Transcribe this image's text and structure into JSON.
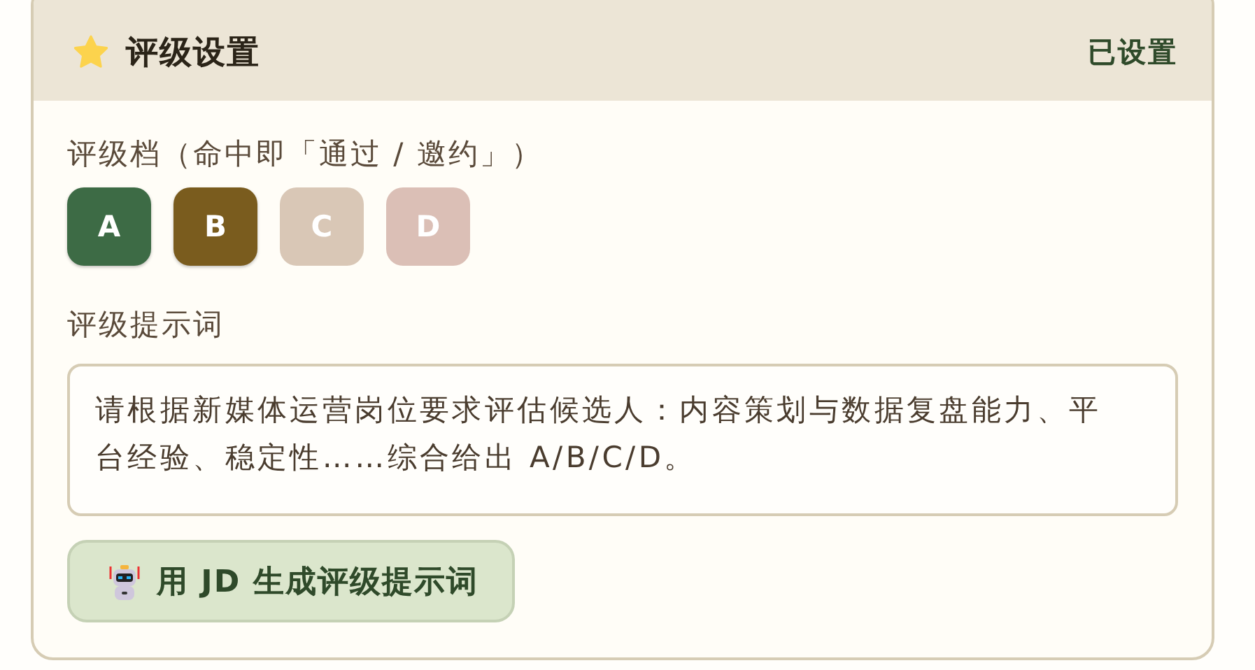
{
  "panel": {
    "title": "评级设置",
    "status": "已设置"
  },
  "grades": {
    "label": "评级档（命中即「通过 / 邀约」）",
    "items": [
      {
        "label": "A",
        "selected": true,
        "color": "#3d6b45"
      },
      {
        "label": "B",
        "selected": true,
        "color": "#7a5c1e"
      },
      {
        "label": "C",
        "selected": false,
        "color": "#d9c7b6"
      },
      {
        "label": "D",
        "selected": false,
        "color": "#dbbfb6"
      }
    ]
  },
  "prompt": {
    "label": "评级提示词",
    "value": "请根据新媒体运营岗位要求评估候选人：内容策划与数据复盘能力、平台经验、稳定性……综合给出 A/B/C/D。"
  },
  "generate_button": {
    "label": "用 JD 生成评级提示词"
  }
}
